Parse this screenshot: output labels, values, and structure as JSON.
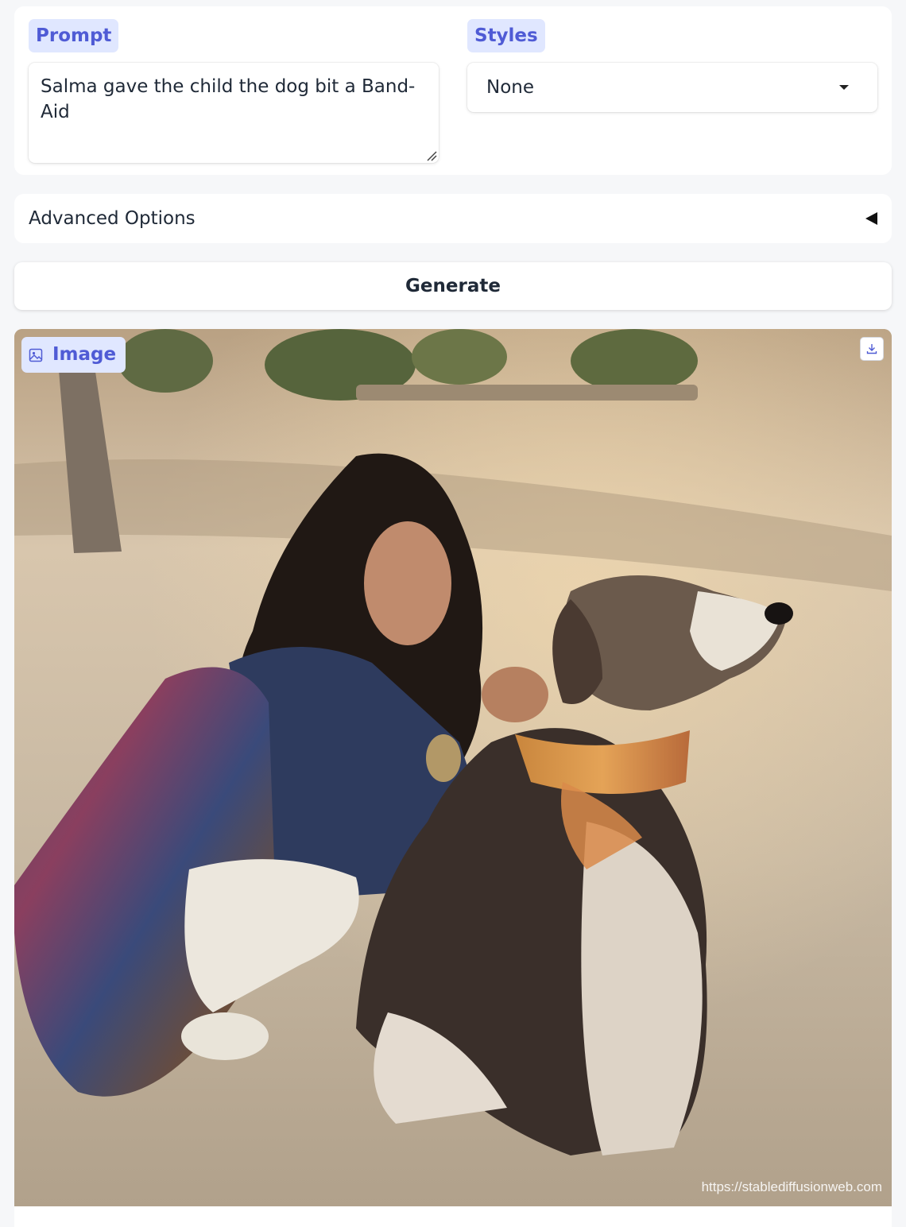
{
  "prompt": {
    "label": "Prompt",
    "value": "Salma gave the child the dog bit a Band-Aid"
  },
  "styles": {
    "label": "Styles",
    "selected": "None"
  },
  "advanced": {
    "label": "Advanced Options"
  },
  "generate": {
    "label": "Generate"
  },
  "output": {
    "label": "Image",
    "watermark": "https://stablediffusionweb.com"
  },
  "colors": {
    "accent": "#4f5bd5",
    "chip_bg": "#e0e7ff",
    "page_bg": "#f6f7f9"
  }
}
